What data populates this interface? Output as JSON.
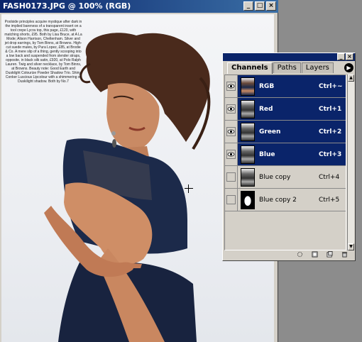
{
  "document": {
    "title": "FASH0173.JPG @ 100% (RGB)",
    "magazine_text": "Poolside principles acquire mystique after dark in the implied bareness of a transparent insert on a tool crepe Lycra top, this page, £120, with matching shorts, £95. Both by Lisa Bruce, at A La Mode; Alison Harrison, Cheltenham. Silver and jet drop earrings, by Tom Binns, at Browns. High-cut suede mules, by Pura Lopez, £85, at Brodie & Co. A mere slip of a thing, gently scooping into a low back and suspended from slender straps, opposite, in black silk satin, £920, at Polo Ralph Lauren. Twig and silver necklace, by Tom Binns, at Browns. Beauty note: Good Earth and Duskilght Colourize Powder Shadow Trio. Shiny Conker Luscious Lipcolour with a shimmering of Duskilight shadow. Both by No.7"
  },
  "palette": {
    "tabs": [
      "Channels",
      "Paths",
      "Layers"
    ],
    "active_tab": 0,
    "channels": [
      {
        "name": "RGB",
        "shortcut": "Ctrl+~",
        "visible": true,
        "selected": true,
        "thumb": "color"
      },
      {
        "name": "Red",
        "shortcut": "Ctrl+1",
        "visible": true,
        "selected": true,
        "thumb": "gray"
      },
      {
        "name": "Green",
        "shortcut": "Ctrl+2",
        "visible": true,
        "selected": true,
        "thumb": "gray"
      },
      {
        "name": "Blue",
        "shortcut": "Ctrl+3",
        "visible": true,
        "selected": true,
        "thumb": "gray"
      },
      {
        "name": "Blue copy",
        "shortcut": "Ctrl+4",
        "visible": false,
        "selected": false,
        "thumb": "gray"
      },
      {
        "name": "Blue copy 2",
        "shortcut": "Ctrl+5",
        "visible": false,
        "selected": false,
        "thumb": "mask"
      }
    ],
    "bottom_icons": [
      "load-selection-icon",
      "save-selection-icon",
      "new-channel-icon",
      "delete-channel-icon"
    ]
  },
  "colors": {
    "title_active": "#0a246a",
    "selection": "#0a246a",
    "dress": "#1c2a4a",
    "skin": "#c8865f",
    "hair": "#4a2a1c"
  }
}
